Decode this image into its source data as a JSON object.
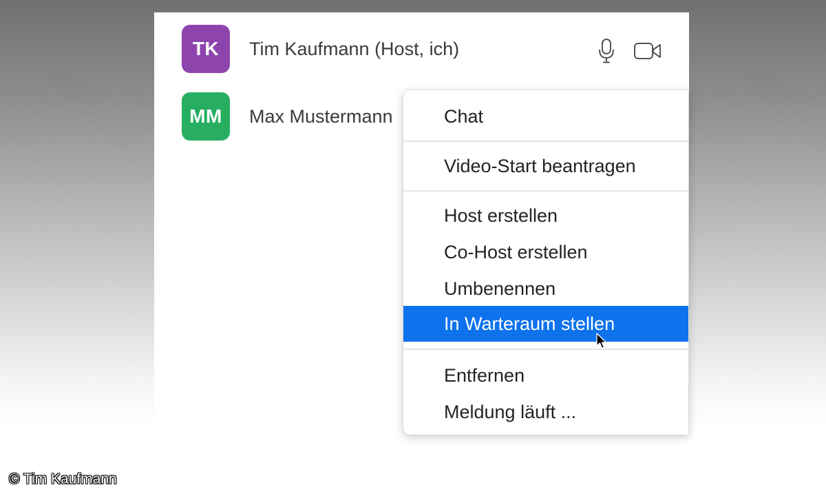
{
  "participants": [
    {
      "initials": "TK",
      "name": "Tim Kaufmann (Host, ich)",
      "avatar_color": "#8e44ad",
      "icons": [
        "microphone-icon",
        "video-camera-icon"
      ]
    },
    {
      "initials": "MM",
      "name": "Max Mustermann",
      "avatar_color": "#27ae60"
    }
  ],
  "context_menu": {
    "items": [
      {
        "label": "Chat"
      },
      {
        "label": "Video-Start beantragen"
      },
      {
        "label": "Host erstellen"
      },
      {
        "label": "Co-Host erstellen"
      },
      {
        "label": "Umbenennen"
      },
      {
        "label": "In Warteraum stellen",
        "highlighted": true
      },
      {
        "label": "Entfernen"
      },
      {
        "label": "Meldung läuft ..."
      }
    ],
    "highlight_color": "#0e72ed"
  },
  "cursor_icon": "mouse-pointer-icon",
  "copyright": "© Tim Kaufmann"
}
